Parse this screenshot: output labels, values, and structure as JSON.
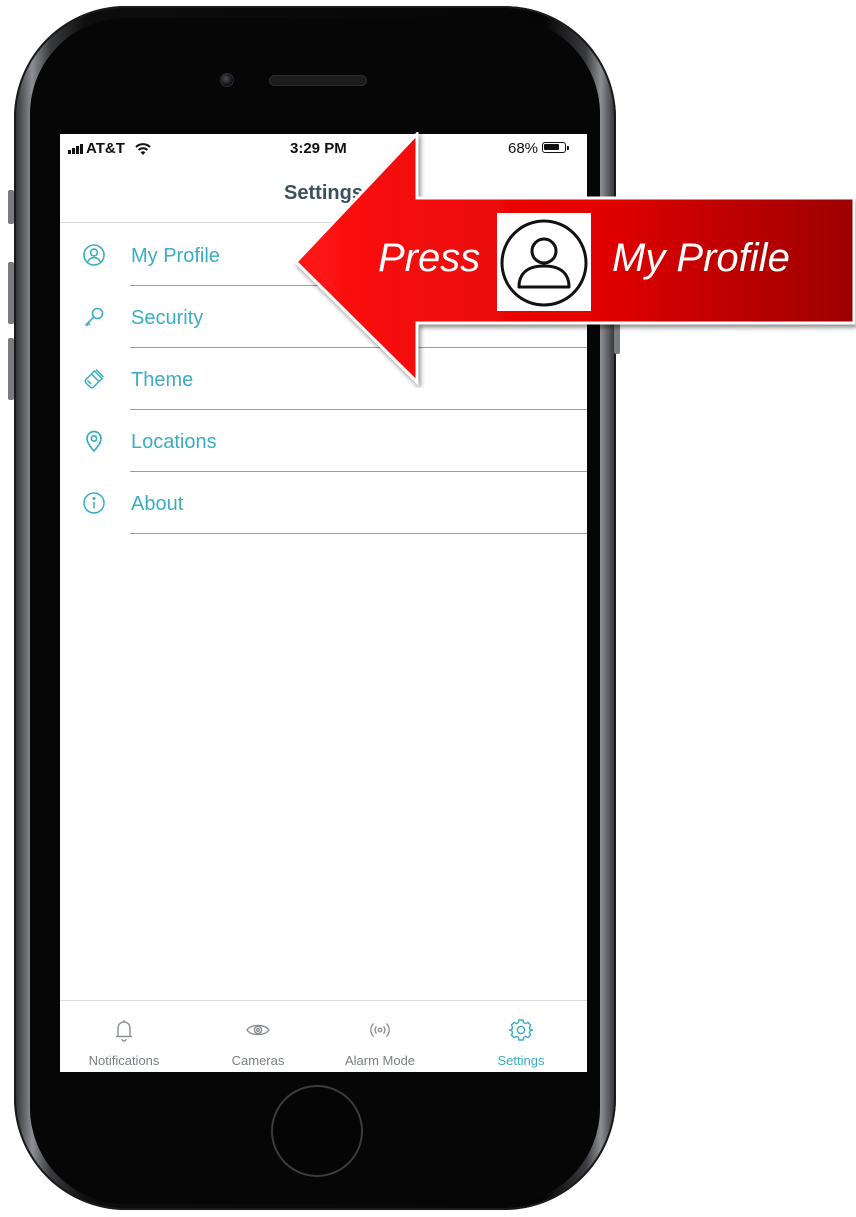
{
  "status_bar": {
    "carrier": "AT&T",
    "time": "3:29 PM",
    "battery": "68%"
  },
  "header": {
    "title": "Settings"
  },
  "menu": [
    {
      "label": "My Profile",
      "icon": "user-circle-icon"
    },
    {
      "label": "Security",
      "icon": "key-icon"
    },
    {
      "label": "Theme",
      "icon": "paintbrush-icon"
    },
    {
      "label": "Locations",
      "icon": "location-pin-icon"
    },
    {
      "label": "About",
      "icon": "info-circle-icon"
    }
  ],
  "tabs": [
    {
      "label": "Notifications",
      "icon": "bell-icon",
      "active": false
    },
    {
      "label": "Cameras",
      "icon": "eye-icon",
      "active": false
    },
    {
      "label": "Alarm Mode",
      "icon": "broadcast-icon",
      "active": false
    },
    {
      "label": "Settings",
      "icon": "gear-icon",
      "active": true
    }
  ],
  "callout": {
    "press": "Press",
    "target": "My Profile",
    "icon": "user-icon"
  },
  "colors": {
    "accent": "#3aaec1",
    "title": "#3b5159",
    "callout_red": "#d40000"
  }
}
